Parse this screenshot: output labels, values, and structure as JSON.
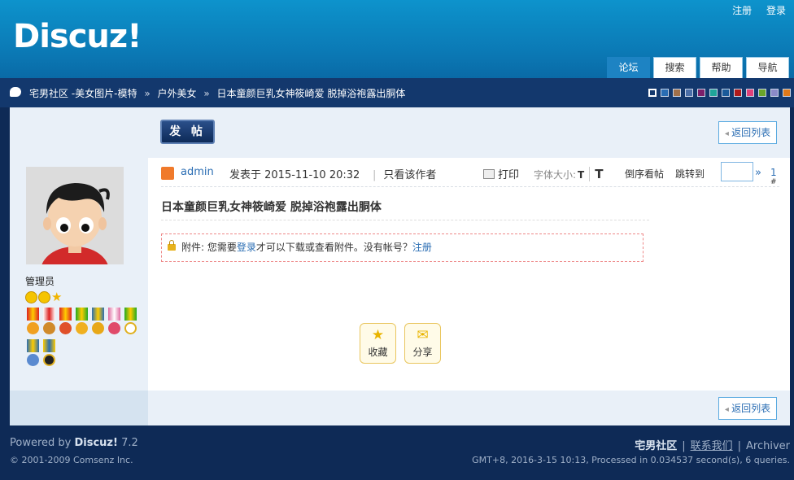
{
  "header": {
    "logo": "Discuz!",
    "top_links": [
      "注册",
      "登录"
    ],
    "nav_tabs": [
      "论坛",
      "搜索",
      "帮助",
      "导航"
    ]
  },
  "breadcrumb": {
    "items": [
      "宅男社区 -美女图片-模特",
      "户外美女",
      "日本童颜巨乳女神筱崎爱 脱掉浴袍露出胴体"
    ],
    "separator": "»"
  },
  "style_swatches": [
    "#13386d",
    "#2a6db3",
    "#a0704a",
    "#4a6ea8",
    "#7c1f6a",
    "#1fa59a",
    "#1a5a9a",
    "#b01a1a",
    "#e0417a",
    "#6aa52a",
    "#8a8ac8",
    "#e07a1a"
  ],
  "toolbar": {
    "post_button": "发 帖",
    "back_to_list": "返回列表"
  },
  "user": {
    "role": "管理员"
  },
  "post": {
    "author": "admin",
    "posted_at": "发表于 2015-11-10 20:32",
    "only_author": "只看该作者",
    "print": "打印",
    "font_size_label": "字体大小:",
    "font_small": "T",
    "font_large": "T",
    "reverse": "倒序看帖",
    "jump_to": "跳转到",
    "jump_go": "»",
    "floor": "1",
    "floor_mark": "#",
    "title": "日本童颜巨乳女神筱崎爱 脱掉浴袍露出胴体",
    "attachment": {
      "prefix": "附件: 您需要",
      "login": "登录",
      "middle": "才可以下载或查看附件。没有帐号？",
      "register": "注册"
    },
    "actions": {
      "favorite": "收藏",
      "share": "分享"
    }
  },
  "bottom": {
    "back_to_list": "返回列表"
  },
  "footer": {
    "powered_prefix": "Powered by ",
    "powered_brand": "Discuz!",
    "powered_version": " 7.2",
    "copyright": "© 2001-2009 Comsenz Inc.",
    "site_name": "宅男社区",
    "contact": "联系我们",
    "archiver": "Archiver",
    "processed": "GMT+8, 2016-3-15 10:13, Processed in 0.034537 second(s), 6 queries."
  }
}
